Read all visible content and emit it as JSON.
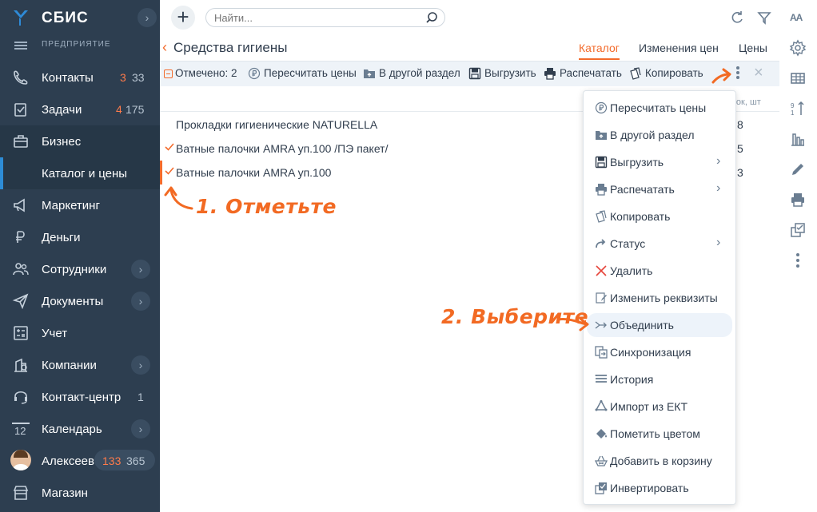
{
  "app": {
    "logo_text": "СБИС",
    "org_label": "ПРЕДПРИЯТИЕ"
  },
  "sidebar": {
    "items": [
      {
        "label": "Контакты",
        "count_red": "3",
        "count_grey": "33",
        "icon": "contacts-icon"
      },
      {
        "label": "Задачи",
        "count_red": "4",
        "count_grey": "175",
        "icon": "tasks-icon"
      },
      {
        "label": "Бизнес",
        "icon": "briefcase-icon"
      },
      {
        "label": "Каталог и цены"
      },
      {
        "label": "Маркетинг",
        "icon": "megaphone-icon"
      },
      {
        "label": "Деньги",
        "icon": "money-icon"
      },
      {
        "label": "Сотрудники",
        "icon": "people-icon"
      },
      {
        "label": "Документы",
        "icon": "send-icon"
      },
      {
        "label": "Учет",
        "icon": "calculator-icon"
      },
      {
        "label": "Компании",
        "icon": "company-icon"
      },
      {
        "label": "Контакт-центр",
        "count_grey": "1",
        "icon": "headset-icon"
      },
      {
        "label": "Календарь",
        "date_badge": "12",
        "icon": "calendar-icon"
      },
      {
        "label": "Алексеев",
        "count_red": "133",
        "count_grey": "365",
        "icon": "avatar"
      },
      {
        "label": "Магазин",
        "icon": "shop-icon"
      }
    ]
  },
  "search": {
    "placeholder": "Найти..."
  },
  "header": {
    "title": "Средства гигиены",
    "tabs": [
      "Каталог",
      "Изменения цен",
      "Цены"
    ]
  },
  "actions": {
    "marked": "Отмечено: 2",
    "recalc": "Пересчитать цены",
    "move": "В другой раздел",
    "export": "Выгрузить",
    "print": "Распечатать",
    "copy": "Копировать"
  },
  "table": {
    "col_remainder": "ток, шт",
    "rows": [
      {
        "name": "Прокладки гигиенические NATURELLA",
        "value": "8",
        "checked": false
      },
      {
        "name": "Ватные палочки AMRA уп.100 /ПЭ пакет/",
        "value": "5",
        "checked": true
      },
      {
        "name": "Ватные палочки AMRA уп.100",
        "value": "3",
        "checked": true
      }
    ]
  },
  "menu": {
    "items": [
      {
        "label": "Пересчитать цены",
        "icon": "ruble-icon",
        "submenu": false
      },
      {
        "label": "В другой раздел",
        "icon": "folder-move-icon",
        "submenu": false
      },
      {
        "label": "Выгрузить",
        "icon": "save-icon",
        "submenu": true
      },
      {
        "label": "Распечатать",
        "icon": "printer-icon",
        "submenu": true
      },
      {
        "label": "Копировать",
        "icon": "copy-icon",
        "submenu": false
      },
      {
        "label": "Статус",
        "icon": "status-arrow-icon",
        "submenu": true
      },
      {
        "label": "Удалить",
        "icon": "delete-icon",
        "submenu": false
      },
      {
        "label": "Изменить реквизиты",
        "icon": "edit-doc-icon",
        "submenu": false
      },
      {
        "label": "Объединить",
        "icon": "merge-icon",
        "submenu": false,
        "hover": true
      },
      {
        "label": "Синхронизация",
        "icon": "sync-icon",
        "submenu": false
      },
      {
        "label": "История",
        "icon": "history-icon",
        "submenu": false
      },
      {
        "label": "Импорт из ЕКТ",
        "icon": "import-icon",
        "submenu": false
      },
      {
        "label": "Пометить цветом",
        "icon": "paint-icon",
        "submenu": false
      },
      {
        "label": "Добавить в корзину",
        "icon": "cart-icon",
        "submenu": false
      },
      {
        "label": "Инвертировать",
        "icon": "invert-icon",
        "submenu": false
      }
    ]
  },
  "annotations": {
    "step1": "1. Отметьте",
    "step2": "2. Выберите"
  },
  "colors": {
    "sidebar_bg": "#2d3e50",
    "accent": "#f36b2c",
    "active_marker": "#2d8cd6"
  }
}
